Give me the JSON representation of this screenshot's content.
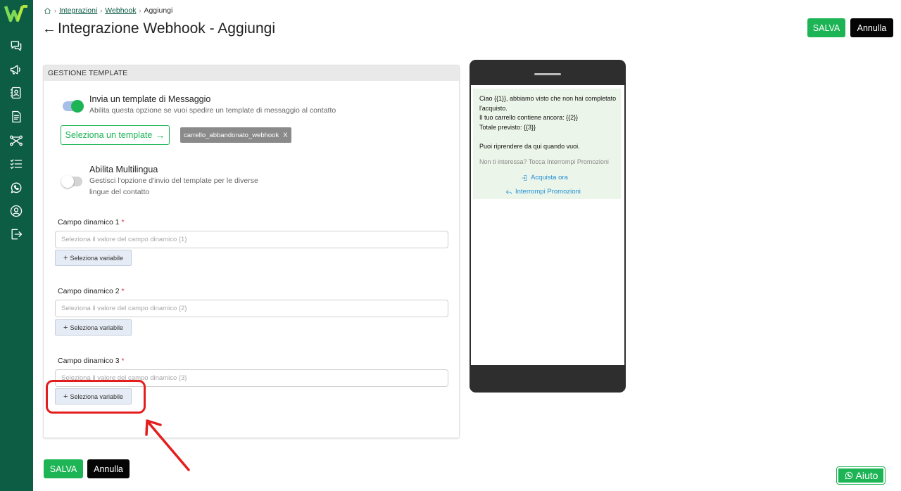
{
  "breadcrumb": {
    "home_icon": "home-icon",
    "items": [
      "Integrazioni",
      "Webhook",
      "Aggiungi"
    ]
  },
  "header": {
    "back_icon": "arrow-left-icon",
    "title": "Integrazione Webhook - Aggiungi",
    "save_label": "SALVA",
    "cancel_label": "Annulla"
  },
  "sidebar": {
    "logo": "W",
    "items": [
      {
        "icon": "chat-icon"
      },
      {
        "icon": "megaphone-icon"
      },
      {
        "icon": "contacts-icon"
      },
      {
        "icon": "document-icon"
      },
      {
        "icon": "flow-icon"
      },
      {
        "icon": "checklist-icon"
      },
      {
        "icon": "whatsapp-icon"
      },
      {
        "icon": "user-icon"
      },
      {
        "icon": "logout-icon"
      }
    ]
  },
  "card": {
    "header": "GESTIONE TEMPLATE",
    "send_template": {
      "title": "Invia un template di Messaggio",
      "description": "Abilita questa opzione se vuoi spedire un template di messaggio al contatto",
      "enabled": true
    },
    "select_template_label": "Seleziona un template",
    "selected_template": "carrello_abbandonato_webhook",
    "tag_close": "X",
    "multilingua": {
      "title": "Abilita Multilingua",
      "description_line1": "Gestisci l'opzione d'invio del template per le diverse",
      "description_line2": "lingue del contatto",
      "enabled": false
    },
    "fields": [
      {
        "label": "Campo dinamico 1",
        "required": "*",
        "placeholder": "Seleziona il valore del campo dinamico {1}",
        "button": "Seleziona variabile"
      },
      {
        "label": "Campo dinamico 2",
        "required": "*",
        "placeholder": "Seleziona il valore del campo dinamico {2}",
        "button": "Seleziona variabile"
      },
      {
        "label": "Campo dinamico 3",
        "required": "*",
        "placeholder": "Seleziona il valore del campo dinamico {3}",
        "button": "Seleziona variabile"
      }
    ]
  },
  "preview": {
    "message": "Ciao {{1}}, abbiamo visto che non hai completato l'acquisto.\nIl tuo carrello contiene ancora: {{2}}\nTotale previsto: {{3}}\n\nPuoi riprendere da qui quando vuoi.",
    "footer": "Non ti interessa? Tocca Interrompi Promozioni",
    "action_buy": "Acquista ora",
    "action_stop": "Interrompi Promozioni"
  },
  "footer": {
    "save_label": "SALVA",
    "cancel_label": "Annulla"
  },
  "help": {
    "label": "Aiuto",
    "icon": "whatsapp-icon"
  },
  "colors": {
    "sidebar": "#0d5c44",
    "primary": "#1db455",
    "dark_button": "#050505",
    "preview_bubble": "#ecf5e9",
    "link_blue": "#1f8fd6",
    "highlight": "#e41e1e"
  }
}
